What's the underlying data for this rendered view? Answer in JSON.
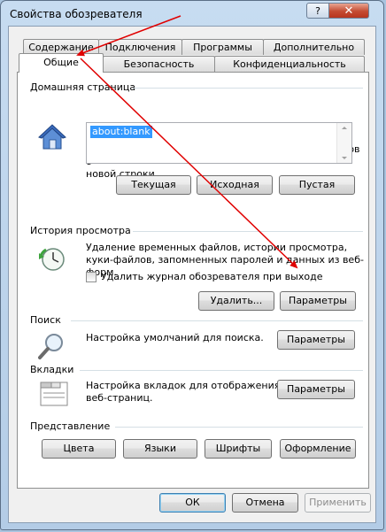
{
  "window": {
    "title": "Свойства обозревателя"
  },
  "titlebar": {
    "help_icon": "?",
    "close_icon": "✕"
  },
  "tabs": {
    "row_top": [
      {
        "label": "Содержание"
      },
      {
        "label": "Подключения"
      },
      {
        "label": "Программы"
      },
      {
        "label": "Дополнительно"
      }
    ],
    "row_bottom": [
      {
        "label": "Общие"
      },
      {
        "label": "Безопасность"
      },
      {
        "label": "Конфиденциальность"
      }
    ]
  },
  "home": {
    "title": "Домашняя страница",
    "desc_line1": "Чтобы создать вкладки, введите каждый из адресов с",
    "desc_line2": "новой строки.",
    "value": "about:blank",
    "buttons": {
      "current": "Текущая",
      "default": "Исходная",
      "blank": "Пустая"
    }
  },
  "history": {
    "title": "История просмотра",
    "desc_line1": "Удаление временных файлов, истории просмотра,",
    "desc_line2": "куки-файлов, запомненных паролей и данных из веб-форм.",
    "checkbox_label": "Удалить журнал обозревателя при выходе",
    "checkbox_checked": false,
    "buttons": {
      "delete": "Удалить...",
      "settings": "Параметры"
    }
  },
  "search": {
    "title": "Поиск",
    "desc": "Настройка умолчаний для поиска.",
    "button": "Параметры"
  },
  "tabs_section": {
    "title": "Вкладки",
    "desc_line1": "Настройка вкладок для отображения",
    "desc_line2": "веб-страниц.",
    "button": "Параметры"
  },
  "appearance": {
    "title": "Представление",
    "buttons": {
      "colors": "Цвета",
      "languages": "Языки",
      "fonts": "Шрифты",
      "accessibility": "Оформление"
    }
  },
  "footer": {
    "ok": "ОК",
    "cancel": "Отмена",
    "apply": "Применить"
  },
  "annotation": {
    "arrow_color": "#e00000"
  }
}
